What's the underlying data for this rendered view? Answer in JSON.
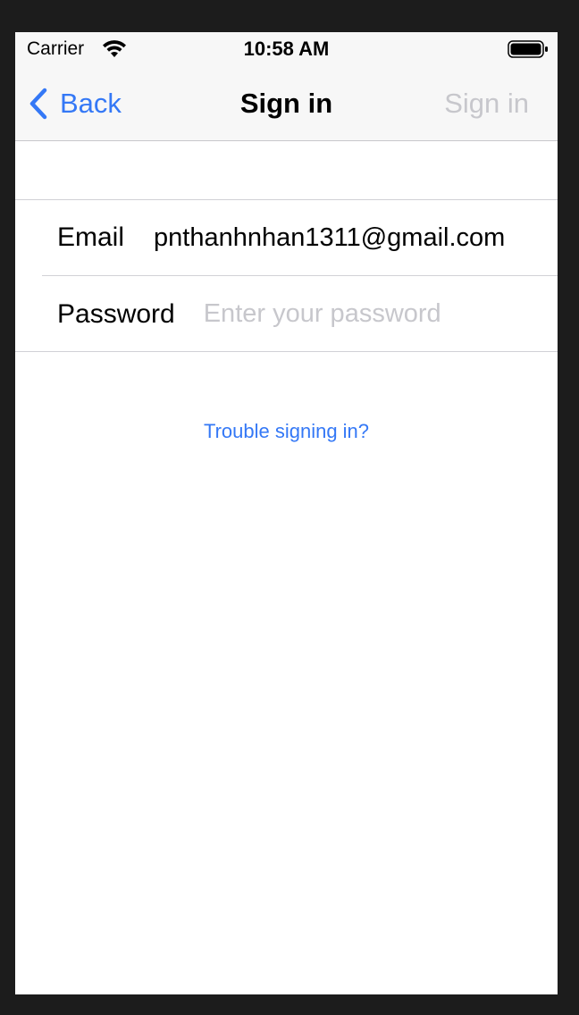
{
  "status_bar": {
    "carrier": "Carrier",
    "time": "10:58 AM",
    "icons": [
      "wifi-icon",
      "battery-icon"
    ]
  },
  "nav": {
    "back_label": "Back",
    "title": "Sign in",
    "action_label": "Sign in",
    "back_icon": "chevron-left-icon"
  },
  "form": {
    "email": {
      "label": "Email",
      "value": "pnthanhnhan1311@gmail.com"
    },
    "password": {
      "label": "Password",
      "value": "",
      "placeholder": "Enter your password"
    }
  },
  "trouble_link": "Trouble signing in?",
  "colors": {
    "accent": "#3478f6",
    "disabled": "#c7c7cc",
    "bar_background": "#f7f7f7",
    "separator": "#d1d1d6",
    "frame": "#1c1c1c"
  }
}
